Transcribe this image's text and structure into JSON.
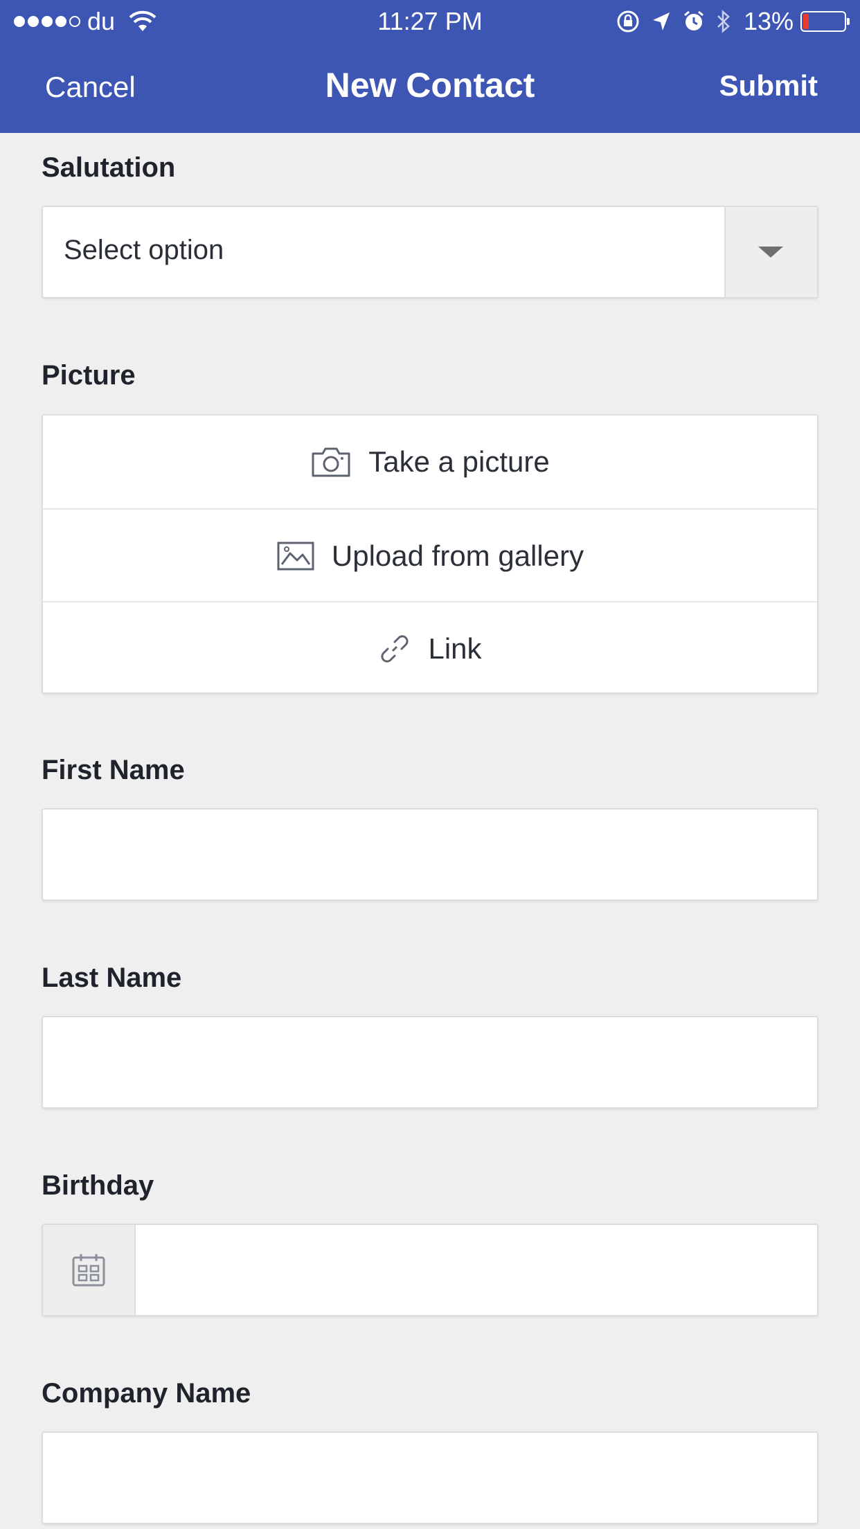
{
  "status_bar": {
    "carrier": "du",
    "time": "11:27 PM",
    "battery_percent_label": "13%",
    "battery_level": 0.13,
    "signal_bars_filled": 4,
    "signal_bars_total": 5
  },
  "nav": {
    "cancel_label": "Cancel",
    "title": "New Contact",
    "submit_label": "Submit"
  },
  "form": {
    "salutation": {
      "label": "Salutation",
      "selected_value": "Select option"
    },
    "picture": {
      "label": "Picture",
      "options": [
        {
          "label": "Take a picture",
          "icon": "camera-icon"
        },
        {
          "label": "Upload from gallery",
          "icon": "image-icon"
        },
        {
          "label": "Link",
          "icon": "link-icon"
        }
      ]
    },
    "first_name": {
      "label": "First Name",
      "value": ""
    },
    "last_name": {
      "label": "Last Name",
      "value": ""
    },
    "birthday": {
      "label": "Birthday",
      "value": "",
      "icon": "calendar-icon"
    },
    "company_name": {
      "label": "Company Name",
      "value": ""
    }
  },
  "colors": {
    "header_background": "#3d56b4",
    "page_background": "#efefef",
    "battery_low": "#e8392c"
  }
}
